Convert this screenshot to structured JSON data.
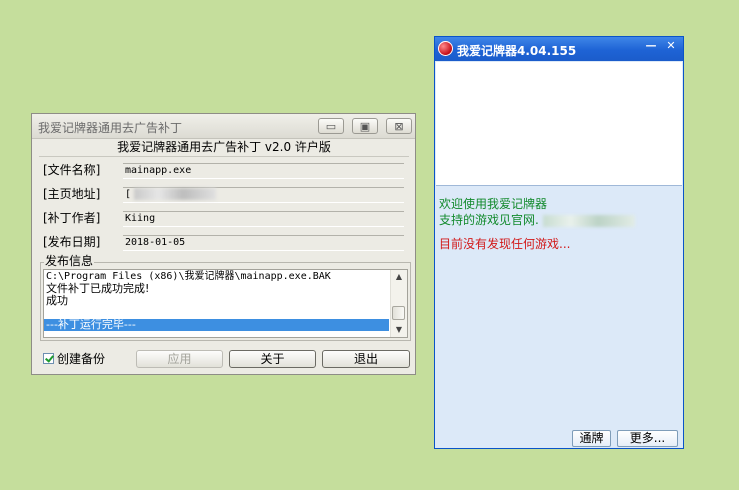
{
  "patcher": {
    "title": "我爱记牌器通用去广告补丁",
    "header": "我爱记牌器通用去广告补丁 v2.0 许户版",
    "fields": [
      {
        "label": "[文件名称]",
        "value": "mainapp.exe"
      },
      {
        "label": "[主页地址]",
        "value": "["
      },
      {
        "label": "[补丁作者]",
        "value": "Kiing"
      },
      {
        "label": "[发布日期]",
        "value": "2018-01-05"
      }
    ],
    "release_label": "发布信息",
    "log_lines": [
      "C:\\Program Files (x86)\\我爱记牌器\\mainapp.exe.BAK",
      "文件补丁已成功完成!",
      "成功",
      "",
      "---补丁运行完毕---"
    ],
    "backup_label": "创建备份",
    "buttons": {
      "apply": "应用",
      "about": "关于",
      "exit": "退出"
    },
    "window_controls": {
      "min": "▭",
      "max": "▣",
      "close": "⊠"
    }
  },
  "app": {
    "title": "我爱记牌器4.04.155",
    "window_controls": {
      "min": "—",
      "close": "✕"
    },
    "messages": {
      "welcome": "欢迎使用我爱记牌器",
      "supported": "支持的游戏见官网.",
      "not_found": "目前没有发现任何游戏..."
    },
    "buttons": {
      "tongpai": "通牌",
      "more": "更多..."
    },
    "colors": {
      "green_text": "#128a2c",
      "red_text": "#d21818",
      "title_blue": "#1e63d5"
    }
  }
}
